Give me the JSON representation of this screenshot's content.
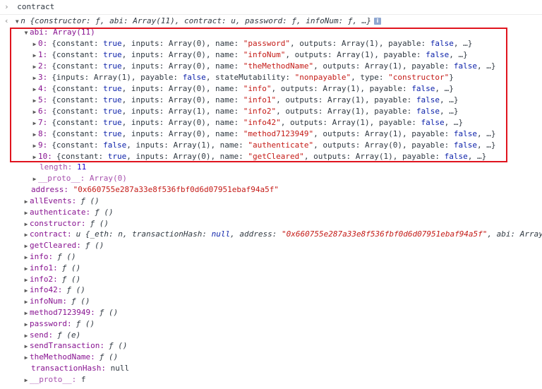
{
  "console": {
    "input_command": "contract",
    "object_preview": "n {constructor: ƒ, abi: Array(11), contract: u, password: ƒ, infoNum: ƒ, …}",
    "abi_header": "abi: Array(11)",
    "abi_entries": [
      {
        "index": "0:",
        "body": "{constant: true, inputs: Array(0), name: \"password\", outputs: Array(1), payable: false, …}"
      },
      {
        "index": "1:",
        "body": "{constant: true, inputs: Array(0), name: \"infoNum\", outputs: Array(1), payable: false, …}"
      },
      {
        "index": "2:",
        "body": "{constant: true, inputs: Array(0), name: \"theMethodName\", outputs: Array(1), payable: false, …}"
      },
      {
        "index": "3:",
        "body": "{inputs: Array(1), payable: false, stateMutability: \"nonpayable\", type: \"constructor\"}"
      },
      {
        "index": "4:",
        "body": "{constant: true, inputs: Array(0), name: \"info\", outputs: Array(1), payable: false, …}"
      },
      {
        "index": "5:",
        "body": "{constant: true, inputs: Array(0), name: \"info1\", outputs: Array(1), payable: false, …}"
      },
      {
        "index": "6:",
        "body": "{constant: true, inputs: Array(1), name: \"info2\", outputs: Array(1), payable: false, …}"
      },
      {
        "index": "7:",
        "body": "{constant: true, inputs: Array(0), name: \"info42\", outputs: Array(1), payable: false, …}"
      },
      {
        "index": "8:",
        "body": "{constant: true, inputs: Array(0), name: \"method7123949\", outputs: Array(1), payable: false, …}"
      },
      {
        "index": "9:",
        "body": "{constant: false, inputs: Array(1), name: \"authenticate\", outputs: Array(0), payable: false, …}"
      },
      {
        "index": "10:",
        "body": "{constant: true, inputs: Array(0), name: \"getCleared\", outputs: Array(1), payable: false, …}"
      }
    ],
    "abi_length_key": "length:",
    "abi_length_value": "11",
    "abi_proto": "__proto__: Array(0)",
    "address_key": "address:",
    "address_value": "\"0x660755e287a33e8f536fbf0d6d07951ebaf94a5f\"",
    "members": [
      {
        "key": "allEvents:",
        "value": "ƒ ()"
      },
      {
        "key": "authenticate:",
        "value": "ƒ ()"
      },
      {
        "key": "constructor:",
        "value": "ƒ ()"
      },
      {
        "key": "contract:",
        "value": "u {_eth: n, transactionHash: null, address: \"0x660755e287a33e8f536fbf0d6d07951ebaf94a5f\", abi: Array("
      },
      {
        "key": "getCleared:",
        "value": "ƒ ()"
      },
      {
        "key": "info:",
        "value": "ƒ ()"
      },
      {
        "key": "info1:",
        "value": "ƒ ()"
      },
      {
        "key": "info2:",
        "value": "ƒ ()"
      },
      {
        "key": "info42:",
        "value": "ƒ ()"
      },
      {
        "key": "infoNum:",
        "value": "ƒ ()"
      },
      {
        "key": "method7123949:",
        "value": "ƒ ()"
      },
      {
        "key": "password:",
        "value": "ƒ ()"
      },
      {
        "key": "send:",
        "value": "ƒ (e)"
      },
      {
        "key": "sendTransaction:",
        "value": "ƒ ()"
      },
      {
        "key": "theMethodName:",
        "value": "ƒ ()"
      }
    ],
    "tx_hash_key": "transactionHash:",
    "tx_hash_value": "null",
    "proto_key": "__proto__:",
    "proto_value": "f"
  },
  "colors": {
    "highlight": "#e0141e",
    "key": "#881391",
    "string": "#c41a16",
    "keyword": "#0d22aa"
  }
}
